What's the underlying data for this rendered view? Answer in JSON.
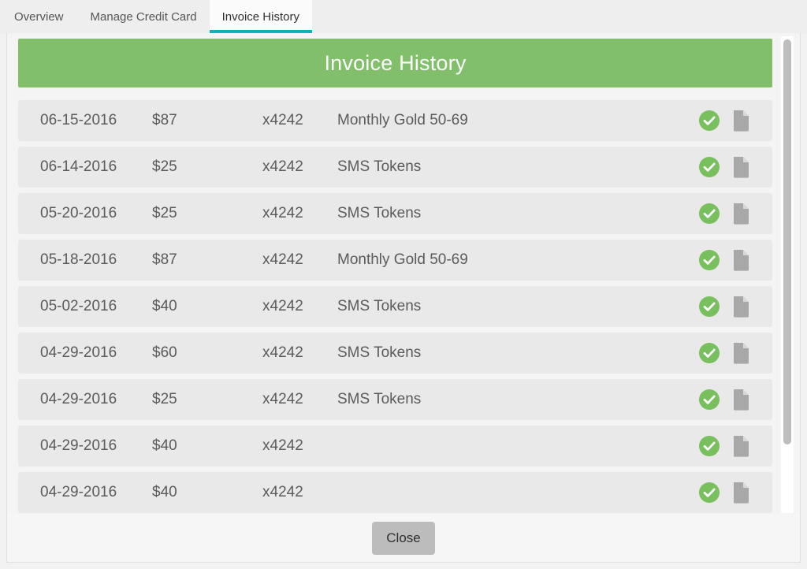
{
  "tabs": [
    {
      "label": "Overview",
      "active": false
    },
    {
      "label": "Manage Credit Card",
      "active": false
    },
    {
      "label": "Invoice History",
      "active": true
    }
  ],
  "modal": {
    "header_title": "Invoice History",
    "header_color": "#81bf6a",
    "accent_color": "#10b0bd",
    "close_label": "Close"
  },
  "table": {
    "rows": [
      {
        "date": "06-15-2016",
        "amount": "$87",
        "card": "x4242",
        "description": "Monthly Gold 50-69",
        "status": "paid",
        "invoice": "document"
      },
      {
        "date": "06-14-2016",
        "amount": "$25",
        "card": "x4242",
        "description": "SMS Tokens",
        "status": "paid",
        "invoice": "document"
      },
      {
        "date": "05-20-2016",
        "amount": "$25",
        "card": "x4242",
        "description": "SMS Tokens",
        "status": "paid",
        "invoice": "document"
      },
      {
        "date": "05-18-2016",
        "amount": "$87",
        "card": "x4242",
        "description": "Monthly Gold 50-69",
        "status": "paid",
        "invoice": "document"
      },
      {
        "date": "05-02-2016",
        "amount": "$40",
        "card": "x4242",
        "description": "SMS Tokens",
        "status": "paid",
        "invoice": "document"
      },
      {
        "date": "04-29-2016",
        "amount": "$60",
        "card": "x4242",
        "description": "SMS Tokens",
        "status": "paid",
        "invoice": "document"
      },
      {
        "date": "04-29-2016",
        "amount": "$25",
        "card": "x4242",
        "description": "SMS Tokens",
        "status": "paid",
        "invoice": "document"
      },
      {
        "date": "04-29-2016",
        "amount": "$40",
        "card": "x4242",
        "description": "",
        "status": "paid",
        "invoice": "document"
      },
      {
        "date": "04-29-2016",
        "amount": "$40",
        "card": "x4242",
        "description": "",
        "status": "paid",
        "invoice": "document"
      }
    ]
  },
  "icons": {
    "status_paid": "check-circle-icon",
    "invoice_doc": "document-icon",
    "check_color": "#78bf5e",
    "doc_color": "#a8a8a8"
  }
}
